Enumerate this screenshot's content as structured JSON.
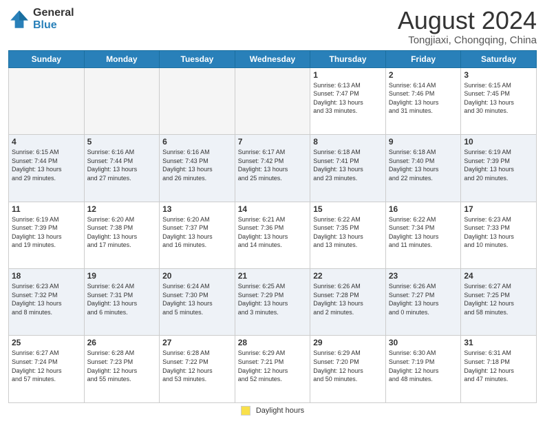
{
  "header": {
    "logo_general": "General",
    "logo_blue": "Blue",
    "month_title": "August 2024",
    "subtitle": "Tongjiaxi, Chongqing, China"
  },
  "footer": {
    "legend_label": "Daylight hours"
  },
  "columns": [
    "Sunday",
    "Monday",
    "Tuesday",
    "Wednesday",
    "Thursday",
    "Friday",
    "Saturday"
  ],
  "weeks": [
    [
      {
        "day": "",
        "info": ""
      },
      {
        "day": "",
        "info": ""
      },
      {
        "day": "",
        "info": ""
      },
      {
        "day": "",
        "info": ""
      },
      {
        "day": "1",
        "info": "Sunrise: 6:13 AM\nSunset: 7:47 PM\nDaylight: 13 hours\nand 33 minutes."
      },
      {
        "day": "2",
        "info": "Sunrise: 6:14 AM\nSunset: 7:46 PM\nDaylight: 13 hours\nand 31 minutes."
      },
      {
        "day": "3",
        "info": "Sunrise: 6:15 AM\nSunset: 7:45 PM\nDaylight: 13 hours\nand 30 minutes."
      }
    ],
    [
      {
        "day": "4",
        "info": "Sunrise: 6:15 AM\nSunset: 7:44 PM\nDaylight: 13 hours\nand 29 minutes."
      },
      {
        "day": "5",
        "info": "Sunrise: 6:16 AM\nSunset: 7:44 PM\nDaylight: 13 hours\nand 27 minutes."
      },
      {
        "day": "6",
        "info": "Sunrise: 6:16 AM\nSunset: 7:43 PM\nDaylight: 13 hours\nand 26 minutes."
      },
      {
        "day": "7",
        "info": "Sunrise: 6:17 AM\nSunset: 7:42 PM\nDaylight: 13 hours\nand 25 minutes."
      },
      {
        "day": "8",
        "info": "Sunrise: 6:18 AM\nSunset: 7:41 PM\nDaylight: 13 hours\nand 23 minutes."
      },
      {
        "day": "9",
        "info": "Sunrise: 6:18 AM\nSunset: 7:40 PM\nDaylight: 13 hours\nand 22 minutes."
      },
      {
        "day": "10",
        "info": "Sunrise: 6:19 AM\nSunset: 7:39 PM\nDaylight: 13 hours\nand 20 minutes."
      }
    ],
    [
      {
        "day": "11",
        "info": "Sunrise: 6:19 AM\nSunset: 7:39 PM\nDaylight: 13 hours\nand 19 minutes."
      },
      {
        "day": "12",
        "info": "Sunrise: 6:20 AM\nSunset: 7:38 PM\nDaylight: 13 hours\nand 17 minutes."
      },
      {
        "day": "13",
        "info": "Sunrise: 6:20 AM\nSunset: 7:37 PM\nDaylight: 13 hours\nand 16 minutes."
      },
      {
        "day": "14",
        "info": "Sunrise: 6:21 AM\nSunset: 7:36 PM\nDaylight: 13 hours\nand 14 minutes."
      },
      {
        "day": "15",
        "info": "Sunrise: 6:22 AM\nSunset: 7:35 PM\nDaylight: 13 hours\nand 13 minutes."
      },
      {
        "day": "16",
        "info": "Sunrise: 6:22 AM\nSunset: 7:34 PM\nDaylight: 13 hours\nand 11 minutes."
      },
      {
        "day": "17",
        "info": "Sunrise: 6:23 AM\nSunset: 7:33 PM\nDaylight: 13 hours\nand 10 minutes."
      }
    ],
    [
      {
        "day": "18",
        "info": "Sunrise: 6:23 AM\nSunset: 7:32 PM\nDaylight: 13 hours\nand 8 minutes."
      },
      {
        "day": "19",
        "info": "Sunrise: 6:24 AM\nSunset: 7:31 PM\nDaylight: 13 hours\nand 6 minutes."
      },
      {
        "day": "20",
        "info": "Sunrise: 6:24 AM\nSunset: 7:30 PM\nDaylight: 13 hours\nand 5 minutes."
      },
      {
        "day": "21",
        "info": "Sunrise: 6:25 AM\nSunset: 7:29 PM\nDaylight: 13 hours\nand 3 minutes."
      },
      {
        "day": "22",
        "info": "Sunrise: 6:26 AM\nSunset: 7:28 PM\nDaylight: 13 hours\nand 2 minutes."
      },
      {
        "day": "23",
        "info": "Sunrise: 6:26 AM\nSunset: 7:27 PM\nDaylight: 13 hours\nand 0 minutes."
      },
      {
        "day": "24",
        "info": "Sunrise: 6:27 AM\nSunset: 7:25 PM\nDaylight: 12 hours\nand 58 minutes."
      }
    ],
    [
      {
        "day": "25",
        "info": "Sunrise: 6:27 AM\nSunset: 7:24 PM\nDaylight: 12 hours\nand 57 minutes."
      },
      {
        "day": "26",
        "info": "Sunrise: 6:28 AM\nSunset: 7:23 PM\nDaylight: 12 hours\nand 55 minutes."
      },
      {
        "day": "27",
        "info": "Sunrise: 6:28 AM\nSunset: 7:22 PM\nDaylight: 12 hours\nand 53 minutes."
      },
      {
        "day": "28",
        "info": "Sunrise: 6:29 AM\nSunset: 7:21 PM\nDaylight: 12 hours\nand 52 minutes."
      },
      {
        "day": "29",
        "info": "Sunrise: 6:29 AM\nSunset: 7:20 PM\nDaylight: 12 hours\nand 50 minutes."
      },
      {
        "day": "30",
        "info": "Sunrise: 6:30 AM\nSunset: 7:19 PM\nDaylight: 12 hours\nand 48 minutes."
      },
      {
        "day": "31",
        "info": "Sunrise: 6:31 AM\nSunset: 7:18 PM\nDaylight: 12 hours\nand 47 minutes."
      }
    ]
  ]
}
